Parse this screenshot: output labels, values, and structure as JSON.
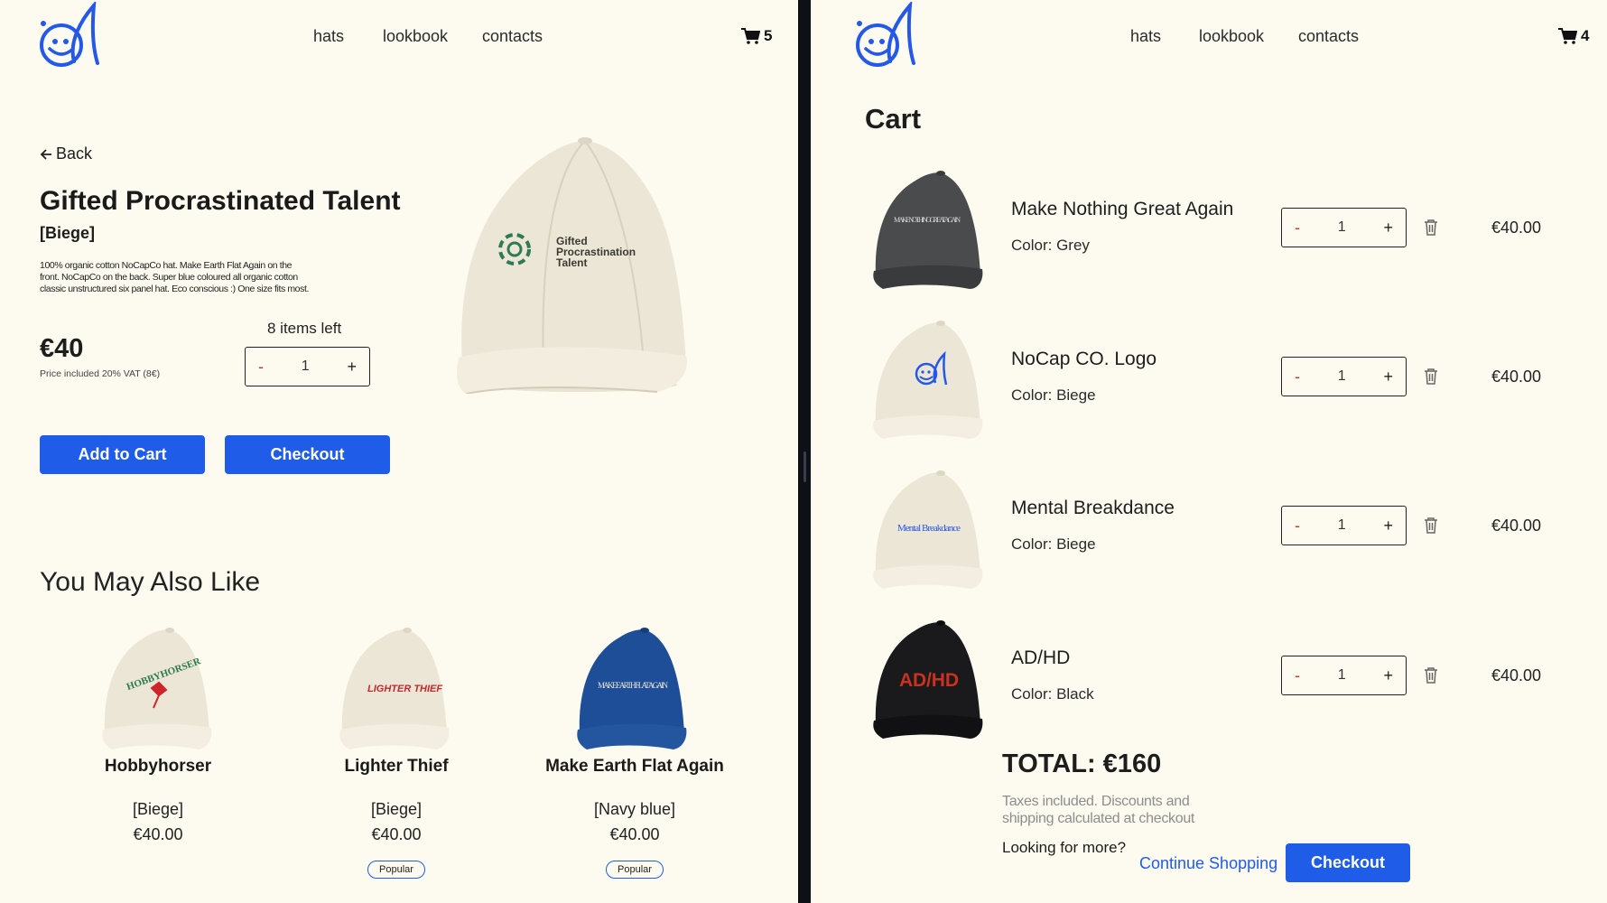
{
  "colors": {
    "background": "#fdfbef",
    "accent": "#1f5ce8",
    "minus": "#c0392b"
  },
  "left": {
    "header": {
      "nav": [
        "hats",
        "lookbook",
        "contacts"
      ],
      "cart_count": "5"
    },
    "product": {
      "back_label": "Back",
      "title": "Gifted Procrastinated Talent",
      "color": "[Biege]",
      "description": "100% organic cotton NoCapCo hat. Make Earth Flat Again on the front. NoCapCo on the back. Super blue coloured all organic cotton classic unstructured six panel hat. Eco conscious :) One size fits most.",
      "price": "€40",
      "vat_note": "Price included 20% VAT (8€)",
      "stock": "8 items left",
      "quantity": {
        "minus": "-",
        "value": "1",
        "plus": "+"
      },
      "add_to_cart": "Add to Cart",
      "checkout": "Checkout",
      "cap_print": [
        "Gifted",
        "Procrastination",
        "Talent"
      ]
    },
    "recommendations": {
      "heading": "You May Also Like",
      "items": [
        {
          "name": "Hobbyhorser",
          "color": "[Biege]",
          "price": "€40.00",
          "badge": "",
          "print": "HOBBYHORSER"
        },
        {
          "name": "Lighter Thief",
          "color": "[Biege]",
          "price": "€40.00",
          "badge": "Popular",
          "print": "LIGHTER THIEF"
        },
        {
          "name": "Make Earth Flat Again",
          "color": "[Navy blue]",
          "price": "€40.00",
          "badge": "Popular",
          "print": "MAKE EARTH FLAT AGAIN"
        }
      ]
    }
  },
  "right": {
    "header": {
      "nav": [
        "hats",
        "lookbook",
        "contacts"
      ],
      "cart_count": "4"
    },
    "cart": {
      "title": "Cart",
      "items": [
        {
          "name": "Make Nothing Great Again",
          "color": "Color: Grey",
          "qty": "1",
          "price": "€40.00",
          "print": "MAKE NOTHING GREAT AGAIN"
        },
        {
          "name": "NoCap CO. Logo",
          "color": "Color: Biege",
          "qty": "1",
          "price": "€40.00",
          "print": ""
        },
        {
          "name": "Mental Breakdance",
          "color": "Color: Biege",
          "qty": "1",
          "price": "€40.00",
          "print": "Mental Breakdance"
        },
        {
          "name": "AD/HD",
          "color": "Color: Black",
          "qty": "1",
          "price": "€40.00",
          "print": "AD/HD"
        }
      ],
      "stepper": {
        "minus": "-",
        "plus": "+"
      },
      "total": "TOTAL: €160",
      "taxes_note": "Taxes included. Discounts and shipping calculated at checkout",
      "looking": "Looking for more?",
      "continue": "Continue Shopping",
      "checkout": "Checkout"
    }
  }
}
